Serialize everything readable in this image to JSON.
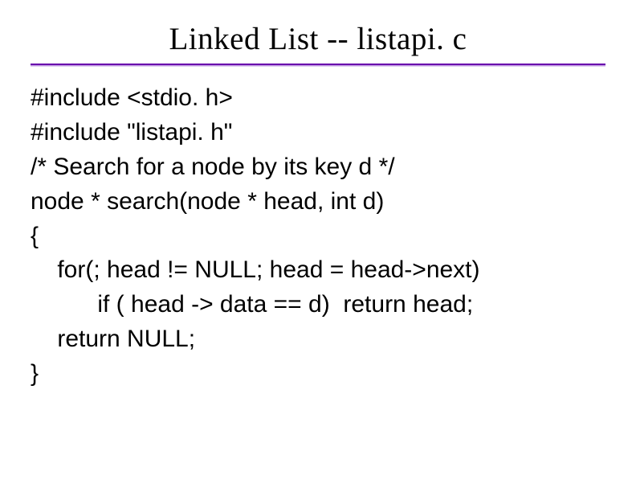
{
  "title": "Linked List -- listapi. c",
  "code": {
    "l1": "#include <stdio. h>",
    "l2": "#include \"listapi. h\"",
    "l3": "/* Search for a node by its key d */",
    "l4": "node * search(node * head, int d)",
    "l5": "{",
    "l6": "    for(; head != NULL; head = head->next)",
    "l7": "          if ( head -> data == d)  return head;",
    "l8": "    return NULL;",
    "l9": "}"
  }
}
